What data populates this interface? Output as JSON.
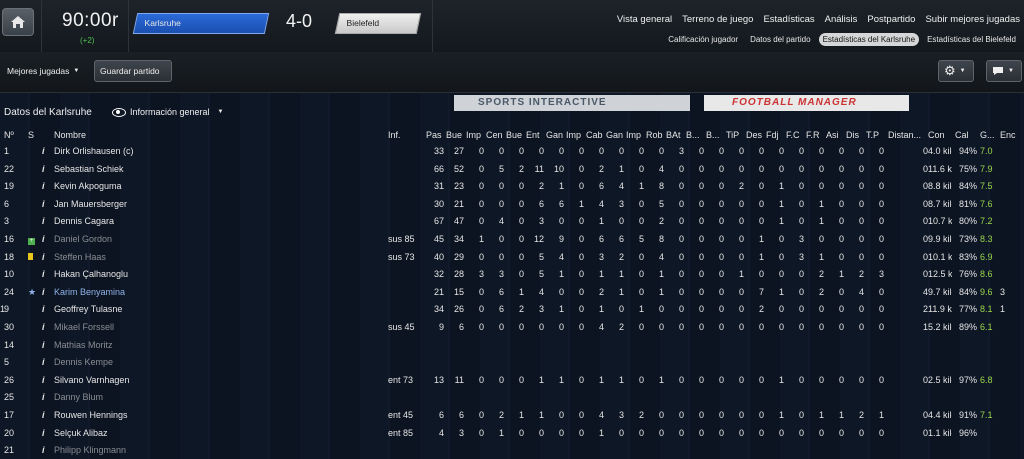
{
  "header": {
    "clock": "90:00r",
    "added_time": "(+2)",
    "home_team": "Karlsruhe",
    "score": "4-0",
    "away_team": "Bielefeld",
    "nav_main": [
      "Vista general",
      "Terreno de juego",
      "Estadísticas",
      "Análisis",
      "Postpartido",
      "Subir mejores jugadas"
    ],
    "nav_sub": [
      "Calificación jugador",
      "Datos del partido",
      "Estadísticas del Karlsruhe",
      "Estadísticas del Bielefeld"
    ],
    "active_sub": 2
  },
  "toolbar": {
    "highlights_label": "Mejores jugadas",
    "save_label": "Guardar partido"
  },
  "ads": {
    "si": "SPORTS INTERACTIVE",
    "fm": "FOOTBALL MANAGER"
  },
  "section": {
    "title": "Datos del Karlsruhe",
    "view_label": "Información general"
  },
  "columns": [
    "Nº",
    "S",
    "Nombre",
    "Inf.",
    "Pas",
    "Bue",
    "Imp",
    "Cen",
    "Bue",
    "Ent",
    "Gan",
    "Imp",
    "Cab",
    "Gan",
    "Imp",
    "Rob",
    "BAt",
    "B...",
    "B...",
    "TiP",
    "Des",
    "Fdj",
    "F.C",
    "F.R",
    "Asi",
    "Dis",
    "T.P",
    "Distan...",
    "Con",
    "Cal",
    "G...",
    "Enc"
  ],
  "colors": {
    "accent_green": "#9bd64a",
    "home": "#2b6ad8",
    "dim_text": "#8a8e93"
  },
  "players": [
    {
      "num": "1",
      "status": "",
      "name": "Dirk Orlishausen (c)",
      "inf": "",
      "stats": [
        "33",
        "27",
        "0",
        "0",
        "0",
        "0",
        "0",
        "0",
        "0",
        "0",
        "0",
        "0",
        "3",
        "0",
        "0",
        "0",
        "0",
        "0",
        "0",
        "0",
        "0",
        "0",
        "0",
        "0"
      ],
      "dist": "4.0 kiló...",
      "con": "94%",
      "cal": "7.0",
      "g": "",
      "enc": "",
      "dim": false
    },
    {
      "num": "22",
      "status": "",
      "name": "Sebastian Schiek",
      "inf": "",
      "stats": [
        "66",
        "52",
        "0",
        "5",
        "2",
        "11",
        "10",
        "0",
        "2",
        "1",
        "0",
        "4",
        "0",
        "0",
        "0",
        "0",
        "0",
        "0",
        "0",
        "0",
        "0",
        "0",
        "0",
        "0"
      ],
      "dist": "11.6 kil...",
      "con": "75%",
      "cal": "7.9",
      "g": "",
      "enc": "",
      "dim": false
    },
    {
      "num": "19",
      "status": "",
      "name": "Kevin Akpoguma",
      "inf": "",
      "stats": [
        "31",
        "23",
        "0",
        "0",
        "0",
        "2",
        "1",
        "0",
        "6",
        "4",
        "1",
        "8",
        "0",
        "0",
        "0",
        "2",
        "0",
        "1",
        "0",
        "0",
        "0",
        "0",
        "0",
        "0"
      ],
      "dist": "8.8 kiló...",
      "con": "84%",
      "cal": "7.5",
      "g": "",
      "enc": "",
      "dim": false
    },
    {
      "num": "6",
      "status": "",
      "name": "Jan Mauersberger",
      "inf": "",
      "stats": [
        "30",
        "21",
        "0",
        "0",
        "0",
        "6",
        "6",
        "1",
        "4",
        "3",
        "0",
        "5",
        "0",
        "0",
        "0",
        "0",
        "0",
        "1",
        "0",
        "1",
        "0",
        "0",
        "0",
        "0"
      ],
      "dist": "8.7 kiló...",
      "con": "81%",
      "cal": "7.6",
      "g": "",
      "enc": "",
      "dim": false
    },
    {
      "num": "3",
      "status": "",
      "name": "Dennis Cagara",
      "inf": "",
      "stats": [
        "67",
        "47",
        "0",
        "4",
        "0",
        "3",
        "0",
        "0",
        "1",
        "0",
        "0",
        "2",
        "0",
        "0",
        "0",
        "0",
        "0",
        "1",
        "0",
        "1",
        "0",
        "0",
        "0",
        "0"
      ],
      "dist": "10.7 kil...",
      "con": "80%",
      "cal": "7.2",
      "g": "",
      "enc": "",
      "dim": false
    },
    {
      "num": "16",
      "status": "sub",
      "name": "Daniel Gordon",
      "inf": "sus 85",
      "stats": [
        "45",
        "34",
        "1",
        "0",
        "0",
        "12",
        "9",
        "0",
        "6",
        "6",
        "5",
        "8",
        "0",
        "0",
        "0",
        "0",
        "1",
        "0",
        "3",
        "0",
        "0",
        "0",
        "0",
        "0"
      ],
      "dist": "9.9 kiló...",
      "con": "73%",
      "cal": "8.3",
      "g": "",
      "enc": "",
      "dim": true
    },
    {
      "num": "18",
      "status": "yellow",
      "name": "Steffen Haas",
      "inf": "sus 73",
      "stats": [
        "40",
        "29",
        "0",
        "0",
        "0",
        "5",
        "4",
        "0",
        "3",
        "2",
        "0",
        "4",
        "0",
        "0",
        "0",
        "0",
        "1",
        "0",
        "3",
        "1",
        "0",
        "0",
        "0",
        "0"
      ],
      "dist": "10.1 kil...",
      "con": "83%",
      "cal": "6.9",
      "g": "",
      "enc": "",
      "dim": true
    },
    {
      "num": "10",
      "status": "",
      "name": "Hakan Çalhanoglu",
      "inf": "",
      "stats": [
        "32",
        "28",
        "3",
        "3",
        "0",
        "5",
        "1",
        "0",
        "1",
        "1",
        "0",
        "1",
        "0",
        "0",
        "0",
        "1",
        "0",
        "0",
        "0",
        "2",
        "1",
        "2",
        "3",
        "0"
      ],
      "dist": "12.5 kil...",
      "con": "76%",
      "cal": "8.6",
      "g": "",
      "enc": "",
      "dim": false
    },
    {
      "num": "24",
      "status": "star",
      "name": "Karim Benyamina",
      "inf": "",
      "stats": [
        "21",
        "15",
        "0",
        "6",
        "1",
        "4",
        "0",
        "0",
        "2",
        "1",
        "0",
        "1",
        "0",
        "0",
        "0",
        "0",
        "7",
        "1",
        "0",
        "2",
        "0",
        "4",
        "0",
        "4"
      ],
      "dist": "9.7 kiló...",
      "con": "84%",
      "cal": "9.6",
      "g": "3",
      "enc": "",
      "dim": false,
      "blue": true
    },
    {
      "num": "9",
      "status": "",
      "name": "Geoffrey Tulasne",
      "inf": "",
      "stats": [
        "34",
        "26",
        "0",
        "6",
        "2",
        "3",
        "1",
        "0",
        "1",
        "0",
        "1",
        "0",
        "0",
        "0",
        "0",
        "0",
        "2",
        "0",
        "0",
        "0",
        "0",
        "0",
        "0",
        "2"
      ],
      "dist": "11.9 kil...",
      "con": "77%",
      "cal": "8.1",
      "g": "1",
      "enc": "1",
      "dim": false
    },
    {
      "num": "30",
      "status": "",
      "name": "Mikael Forssell",
      "inf": "sus 45",
      "stats": [
        "9",
        "6",
        "0",
        "0",
        "0",
        "0",
        "0",
        "0",
        "4",
        "2",
        "0",
        "0",
        "0",
        "0",
        "0",
        "0",
        "0",
        "0",
        "0",
        "0",
        "0",
        "0",
        "0",
        "1"
      ],
      "dist": "5.2 kiló...",
      "con": "89%",
      "cal": "6.1",
      "g": "",
      "enc": "",
      "dim": true
    },
    {
      "num": "14",
      "status": "",
      "name": "Mathias Moritz",
      "inf": "",
      "stats": [
        "",
        "",
        "",
        "",
        "",
        "",
        "",
        "",
        "",
        "",
        "",
        "",
        "",
        "",
        "",
        "",
        "",
        "",
        "",
        "",
        "",
        "",
        "",
        ""
      ],
      "dist": "",
      "con": "",
      "cal": "",
      "g": "",
      "enc": "",
      "dim": true
    },
    {
      "num": "5",
      "status": "",
      "name": "Dennis Kempe",
      "inf": "",
      "stats": [
        "",
        "",
        "",
        "",
        "",
        "",
        "",
        "",
        "",
        "",
        "",
        "",
        "",
        "",
        "",
        "",
        "",
        "",
        "",
        "",
        "",
        "",
        "",
        ""
      ],
      "dist": "",
      "con": "",
      "cal": "",
      "g": "",
      "enc": "",
      "dim": true
    },
    {
      "num": "26",
      "status": "",
      "name": "Silvano Varnhagen",
      "inf": "ent 73",
      "stats": [
        "13",
        "11",
        "0",
        "0",
        "0",
        "1",
        "1",
        "0",
        "1",
        "1",
        "0",
        "1",
        "0",
        "0",
        "0",
        "0",
        "0",
        "1",
        "0",
        "0",
        "0",
        "0",
        "0",
        "0"
      ],
      "dist": "2.5 kiló...",
      "con": "97%",
      "cal": "6.8",
      "g": "",
      "enc": "",
      "dim": false
    },
    {
      "num": "25",
      "status": "",
      "name": "Danny Blum",
      "inf": "",
      "stats": [
        "",
        "",
        "",
        "",
        "",
        "",
        "",
        "",
        "",
        "",
        "",
        "",
        "",
        "",
        "",
        "",
        "",
        "",
        "",
        "",
        "",
        "",
        "",
        ""
      ],
      "dist": "",
      "con": "",
      "cal": "",
      "g": "",
      "enc": "",
      "dim": true
    },
    {
      "num": "17",
      "status": "",
      "name": "Rouwen Hennings",
      "inf": "ent 45",
      "stats": [
        "6",
        "6",
        "0",
        "2",
        "1",
        "1",
        "0",
        "0",
        "4",
        "3",
        "2",
        "0",
        "0",
        "0",
        "0",
        "0",
        "0",
        "1",
        "0",
        "1",
        "1",
        "2",
        "1",
        "0"
      ],
      "dist": "4.4 kiló...",
      "con": "91%",
      "cal": "7.1",
      "g": "",
      "enc": "",
      "dim": false
    },
    {
      "num": "20",
      "status": "",
      "name": "Selçuk Alibaz",
      "inf": "ent 85",
      "stats": [
        "4",
        "3",
        "0",
        "1",
        "0",
        "0",
        "0",
        "0",
        "1",
        "0",
        "0",
        "0",
        "0",
        "0",
        "0",
        "0",
        "0",
        "0",
        "0",
        "0",
        "0",
        "0",
        "0",
        "0"
      ],
      "dist": "1.1 kiló...",
      "con": "96%",
      "cal": "",
      "g": "",
      "enc": "",
      "dim": false
    },
    {
      "num": "21",
      "status": "",
      "name": "Philipp Klingmann",
      "inf": "",
      "stats": [
        "",
        "",
        "",
        "",
        "",
        "",
        "",
        "",
        "",
        "",
        "",
        "",
        "",
        "",
        "",
        "",
        "",
        "",
        "",
        "",
        "",
        "",
        "",
        ""
      ],
      "dist": "",
      "con": "",
      "cal": "",
      "g": "",
      "enc": "",
      "dim": true
    }
  ]
}
